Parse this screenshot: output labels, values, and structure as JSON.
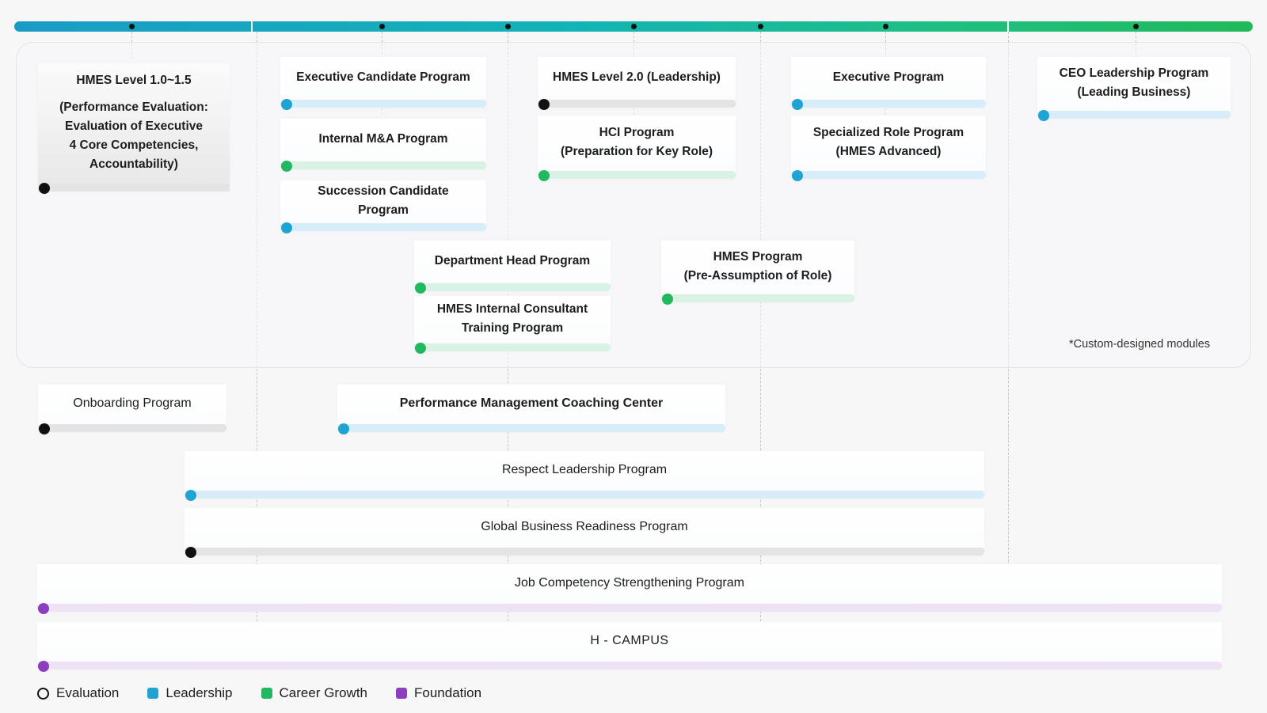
{
  "timeline": {
    "color_start": "#1a9bc6",
    "color_end": "#22b95a"
  },
  "note": "*Custom-designed modules",
  "programs": [
    {
      "id": "hmes-level-1",
      "category": "Evaluation",
      "title": "HMES Level 1.0~1.5",
      "lines": [
        "(Performance Evaluation:",
        "Evaluation of Executive",
        "4 Core Competencies,",
        "Accountability)"
      ]
    },
    {
      "id": "executive-candidate",
      "category": "Leadership",
      "title": "Executive Candidate Program"
    },
    {
      "id": "internal-ma",
      "category": "Career Growth",
      "title": "Internal M&A Program"
    },
    {
      "id": "succession-candidate",
      "category": "Leadership",
      "title": "Succession Candidate Program"
    },
    {
      "id": "hmes-level-2",
      "category": "Evaluation",
      "title": "HMES Level 2.0 (Leadership)"
    },
    {
      "id": "hci",
      "category": "Career Growth",
      "title": "HCI Program",
      "lines": [
        "(Preparation for Key Role)"
      ]
    },
    {
      "id": "executive",
      "category": "Leadership",
      "title": "Executive Program"
    },
    {
      "id": "specialized-role",
      "category": "Leadership",
      "title": "Specialized Role Program",
      "lines": [
        "(HMES Advanced)"
      ]
    },
    {
      "id": "ceo-leadership",
      "category": "Leadership",
      "title": "CEO Leadership Program",
      "lines": [
        "(Leading Business)"
      ]
    },
    {
      "id": "department-head",
      "category": "Career Growth",
      "title": "Department Head Program"
    },
    {
      "id": "hmes-internal-consultant",
      "category": "Career Growth",
      "title": "HMES Internal Consultant",
      "lines": [
        "Training Program"
      ]
    },
    {
      "id": "hmes-program",
      "category": "Career Growth",
      "title": "HMES Program",
      "lines": [
        "(Pre-Assumption of Role)"
      ]
    },
    {
      "id": "onboarding",
      "category": "Evaluation",
      "title": "Onboarding Program"
    },
    {
      "id": "performance-coaching",
      "category": "Leadership",
      "title": "Performance Management Coaching Center"
    },
    {
      "id": "respect-leadership",
      "category": "Leadership",
      "title": "Respect Leadership Program"
    },
    {
      "id": "global-business",
      "category": "Evaluation",
      "title": "Global Business Readiness Program"
    },
    {
      "id": "job-competency",
      "category": "Foundation",
      "title": "Job Competency Strengthening Program"
    },
    {
      "id": "h-campus",
      "category": "Foundation",
      "title": "H - CAMPUS"
    }
  ],
  "legend": [
    {
      "label": "Evaluation",
      "color": "#111111"
    },
    {
      "label": "Leadership",
      "color": "#1fa3d2"
    },
    {
      "label": "Career Growth",
      "color": "#21b861"
    },
    {
      "label": "Foundation",
      "color": "#8b3fbd"
    }
  ]
}
